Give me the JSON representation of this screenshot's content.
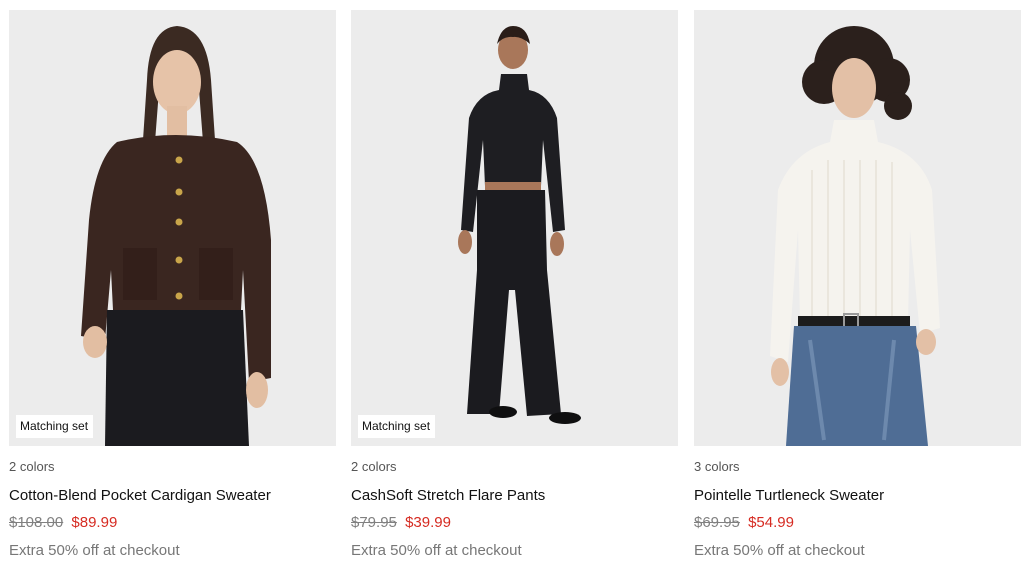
{
  "colors": {
    "sale": "#d62b22",
    "old": "#808080",
    "image_bg": "#ececec"
  },
  "products": [
    {
      "badge": "Matching set",
      "colors_count": "2 colors",
      "name": "Cotton-Blend Pocket Cardigan Sweater",
      "old_price": "$108.00",
      "sale_price": "$89.99",
      "promo": "Extra 50% off at checkout"
    },
    {
      "badge": "Matching set",
      "colors_count": "2 colors",
      "name": "CashSoft Stretch Flare Pants",
      "old_price": "$79.95",
      "sale_price": "$39.99",
      "promo": "Extra 50% off at checkout"
    },
    {
      "badge": "",
      "colors_count": "3 colors",
      "name": "Pointelle Turtleneck Sweater",
      "old_price": "$69.95",
      "sale_price": "$54.99",
      "promo": "Extra 50% off at checkout"
    }
  ]
}
